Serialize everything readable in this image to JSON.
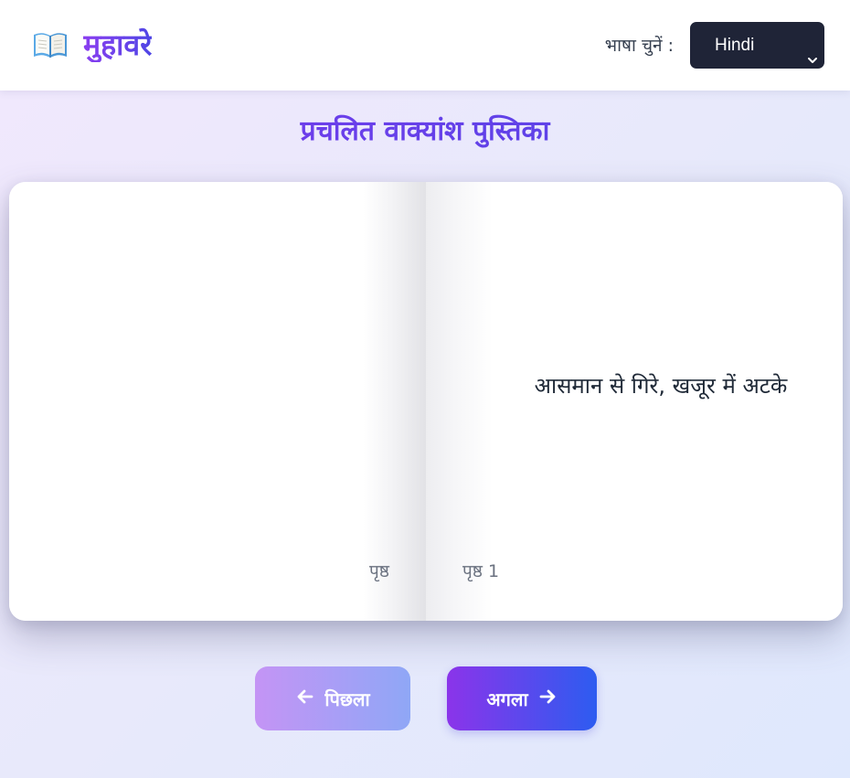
{
  "header": {
    "logo_icon": "open-book-icon",
    "title": "मुहावरे",
    "language_label": "भाषा चुनें :",
    "language_select": {
      "selected": "Hindi",
      "icon": "chevron-down-icon"
    }
  },
  "subtitle": "प्रचलित वाक्यांश पुस्तिका",
  "book": {
    "left_page": {
      "text": "",
      "page_label": "पृष्ठ"
    },
    "right_page": {
      "text": "आसमान से गिरे, खजूर में अटके",
      "page_label": "पृष्ठ 1"
    }
  },
  "nav": {
    "prev_label": "पिछला",
    "prev_icon": "arrow-left-icon",
    "next_label": "अगला",
    "next_icon": "arrow-right-icon"
  },
  "colors": {
    "accent_purple": "#7c3aed",
    "accent_blue": "#2d5cf0",
    "select_bg": "#1f2437"
  }
}
